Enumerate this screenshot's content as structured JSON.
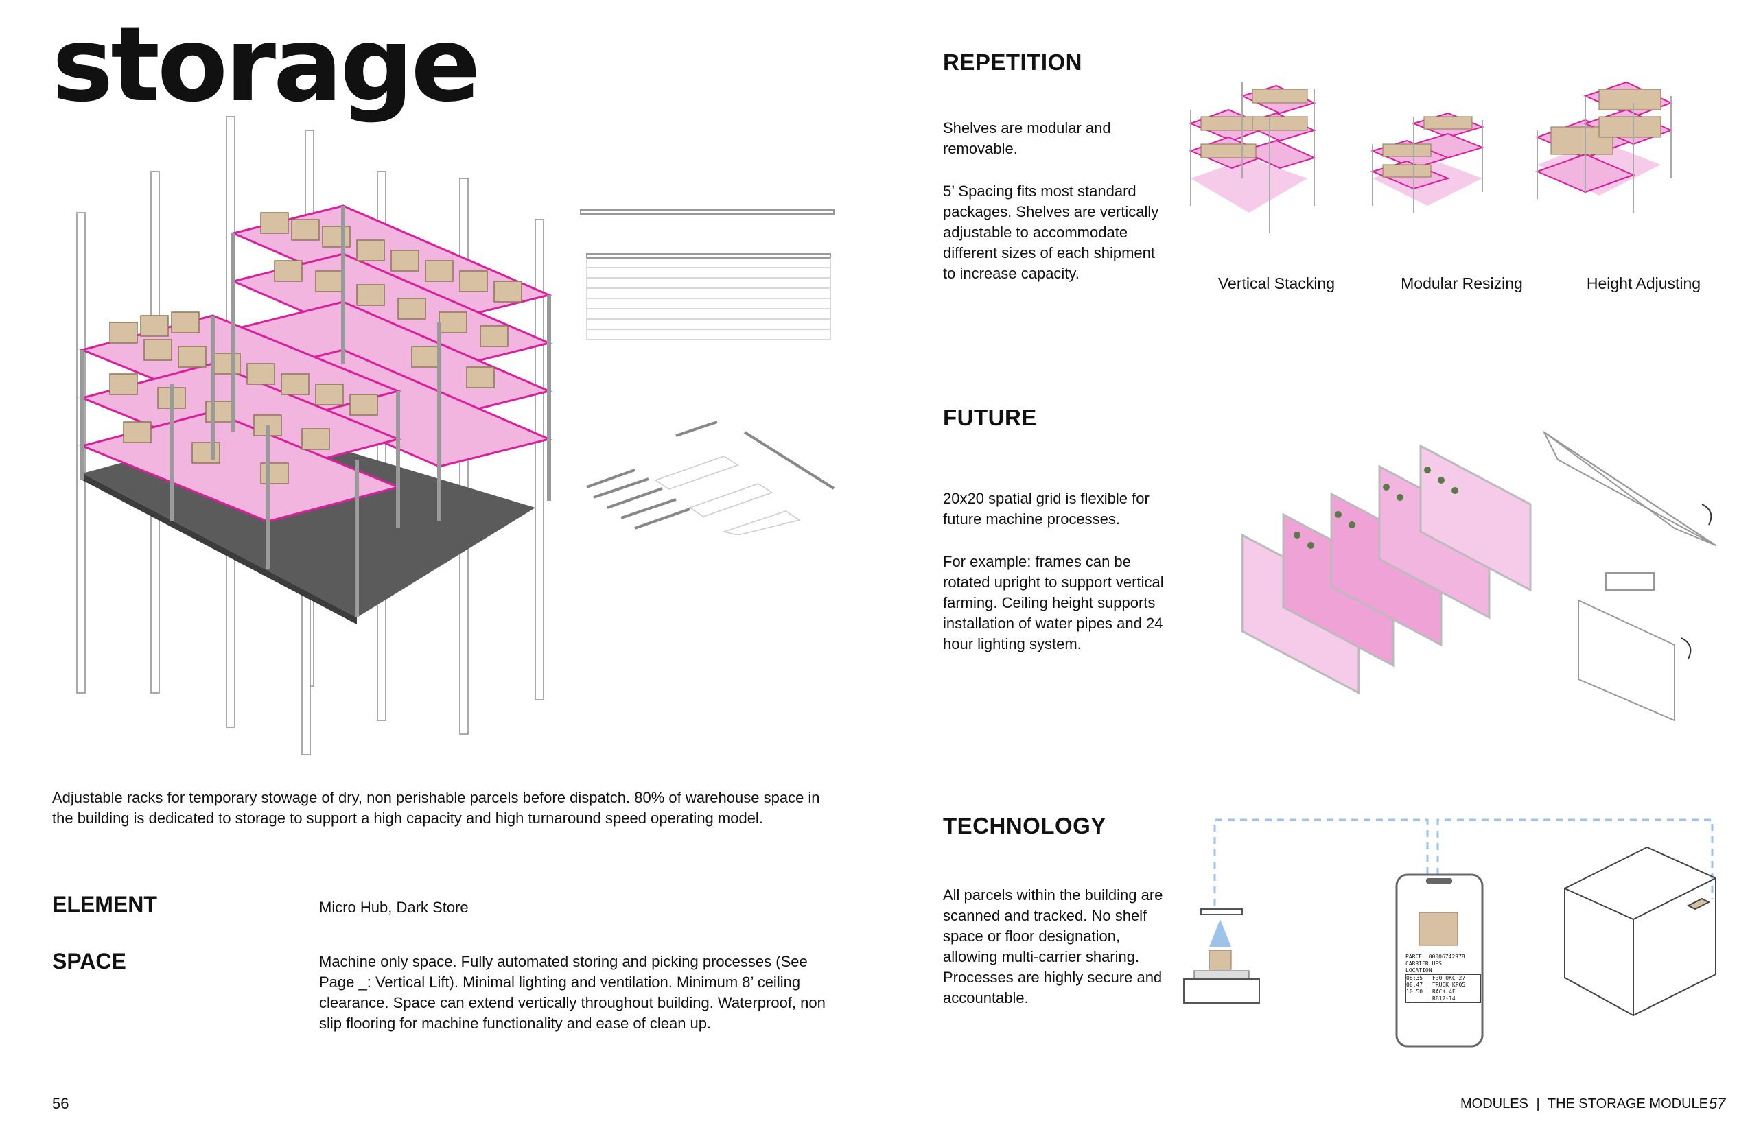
{
  "left": {
    "title": "storage",
    "description": "Adjustable racks for temporary stowage of dry, non perishable parcels before dispatch. 80% of warehouse space in the building is dedicated to storage to support a high capacity and high turnaround speed operating model.",
    "element_label": "ELEMENT",
    "element_value": "Micro Hub, Dark Store",
    "space_label": "SPACE",
    "space_value": "Machine only space. Fully automated storing and picking processes (See Page _: Vertical Lift). Minimal lighting and ventilation. Minimum 8’ ceiling clearance. Space can extend vertically throughout building. Waterproof, non slip flooring for machine functionality and ease of clean up.",
    "page_number": "56"
  },
  "right": {
    "repetition": {
      "heading": "REPETITION",
      "text1": "Shelves are modular and removable.",
      "text2": "5’ Spacing fits most standard packages. Shelves are vertically adjustable to accommodate different sizes of each shipment to increase capacity.",
      "captions": [
        "Vertical Stacking",
        "Modular Resizing",
        "Height Adjusting"
      ]
    },
    "future": {
      "heading": "FUTURE",
      "text1": "20x20 spatial grid is flexible for future machine processes.",
      "text2": "For example: frames can be rotated upright to support vertical farming. Ceiling height supports installation of water pipes and 24 hour lighting system."
    },
    "technology": {
      "heading": "TECHNOLOGY",
      "text": "All parcels within the building are scanned and tracked. No shelf space or floor designation, allowing multi-carrier sharing. Processes are highly secure and accountable.",
      "phone": {
        "parcel": "PARCEL 00006742978",
        "carrier": "CARRIER UPS",
        "location": "LOCATION",
        "rows": [
          "08:35",
          "F30 OKC 27",
          "08:47",
          "TRUCK KP05",
          "10:50",
          "RACK 4F",
          "",
          "RB17-14"
        ]
      }
    },
    "footer_left": "MODULES",
    "footer_right": "THE STORAGE MODULE",
    "page_number": "57"
  },
  "colors": {
    "accent": "#d9209b",
    "box": "#d8c1a3",
    "floor": "#5b5b5b",
    "scan_line": "#9dc3ea"
  }
}
